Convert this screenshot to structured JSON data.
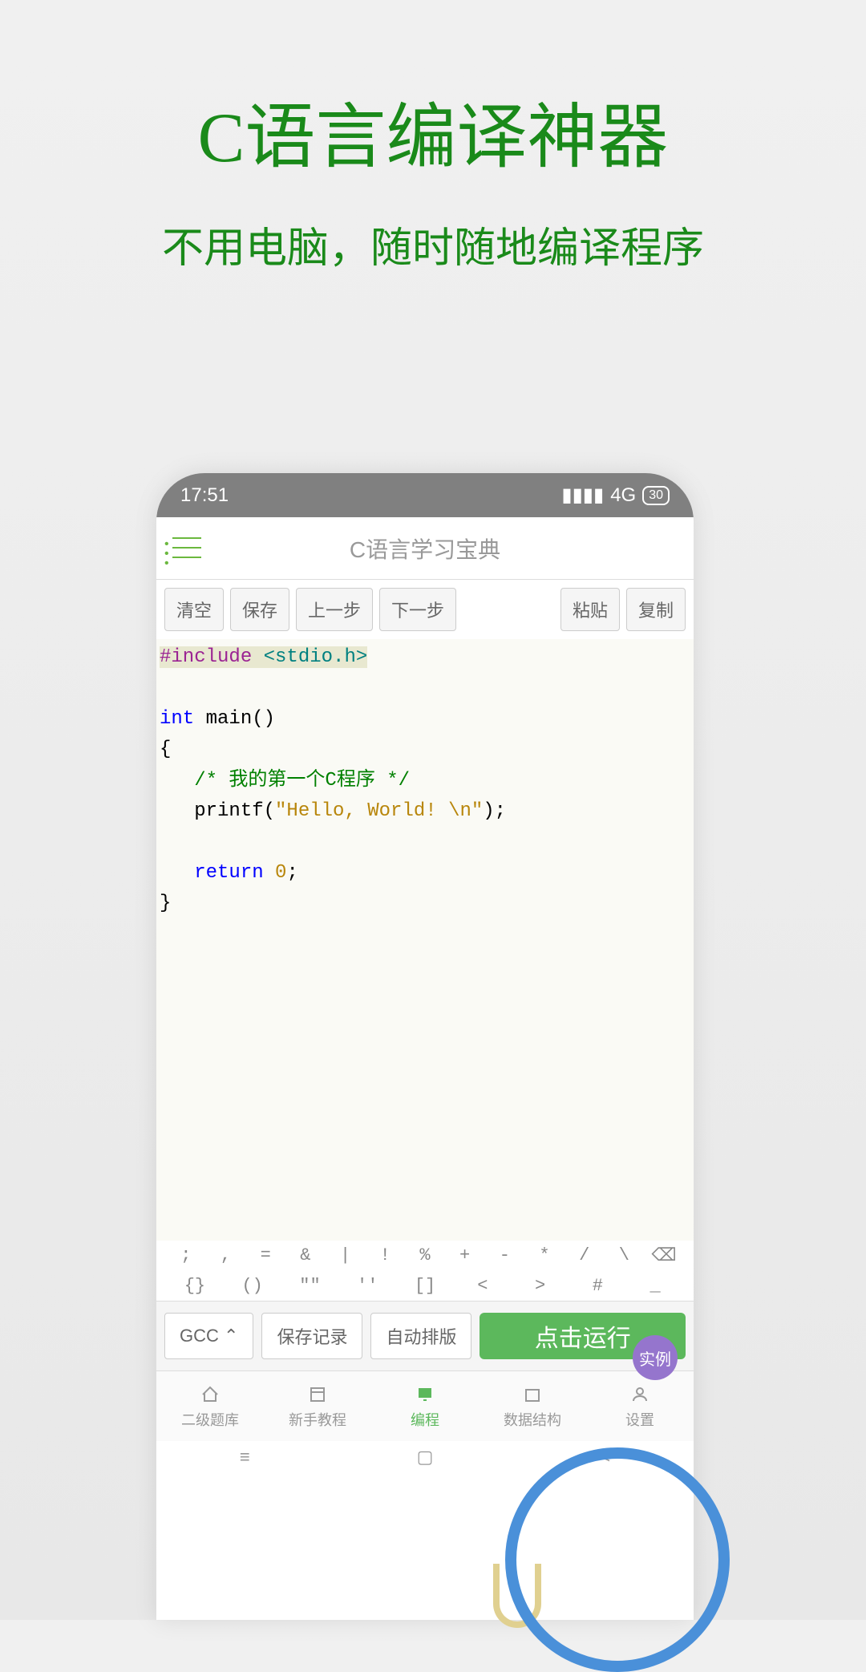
{
  "promo": {
    "title": "C语言编译神器",
    "subtitle": "不用电脑，随时随地编译程序"
  },
  "statusbar": {
    "time": "17:51",
    "network": "4G",
    "battery": "30"
  },
  "header": {
    "title": "C语言学习宝典"
  },
  "toolbar": {
    "clear": "清空",
    "save": "保存",
    "undo": "上一步",
    "redo": "下一步",
    "paste": "粘贴",
    "copy": "复制"
  },
  "code": {
    "line1_include": "#include",
    "line1_header": "<stdio.h>",
    "line2_int": "int",
    "line2_main": " main()",
    "line3": "{",
    "line4_comment": "   /* 我的第一个C程序 */",
    "line5_pre": "   printf(",
    "line5_str": "\"Hello, World! \\n\"",
    "line5_post": ");",
    "line6_return": "   return",
    "line6_zero": " 0",
    "line6_semi": ";",
    "line7": "}"
  },
  "example_badge": "实例",
  "symbols1": [
    ";",
    ",",
    "=",
    "&",
    "|",
    "!",
    "%",
    "+",
    "-",
    "*",
    "/",
    "\\",
    "⌫"
  ],
  "symbols2": [
    "{}",
    "()",
    "\"\"",
    "''",
    "[]",
    "<",
    ">",
    "#",
    "_"
  ],
  "bottom": {
    "gcc": "GCC ⌃",
    "save_record": "保存记录",
    "auto_format": "自动排版",
    "run": "点击运行"
  },
  "nav": {
    "items": [
      {
        "label": "二级题库"
      },
      {
        "label": "新手教程"
      },
      {
        "label": "编程"
      },
      {
        "label": "数据结构"
      },
      {
        "label": "设置"
      }
    ]
  },
  "sysnav": [
    "≡",
    "▢",
    "<"
  ]
}
